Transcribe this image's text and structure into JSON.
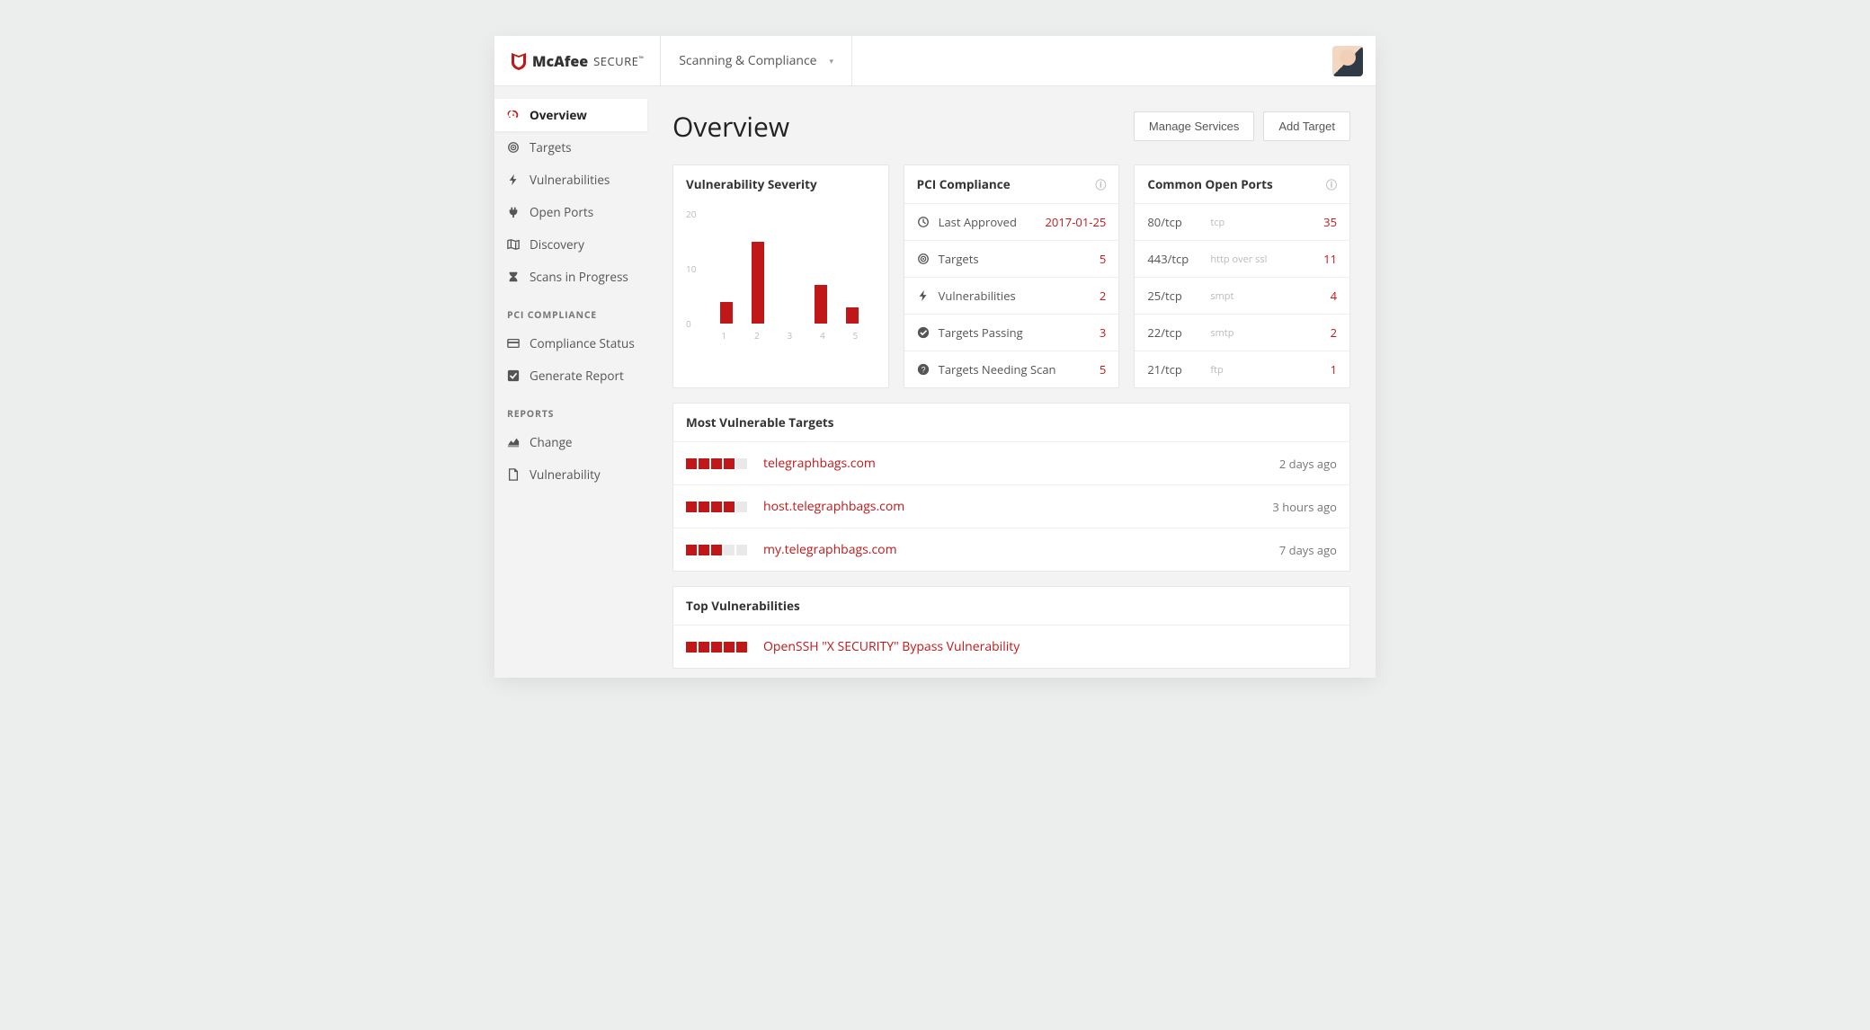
{
  "brand": {
    "part1": "McAfee",
    "part2": "SECURE",
    "tm": "™"
  },
  "header": {
    "nav_label": "Scanning & Compliance"
  },
  "sidebar": {
    "main": [
      {
        "label": "Overview",
        "icon": "gauge",
        "active": true
      },
      {
        "label": "Targets",
        "icon": "target",
        "active": false
      },
      {
        "label": "Vulnerabilities",
        "icon": "bolt",
        "active": false
      },
      {
        "label": "Open Ports",
        "icon": "plug",
        "active": false
      },
      {
        "label": "Discovery",
        "icon": "map",
        "active": false
      },
      {
        "label": "Scans in Progress",
        "icon": "hourglass",
        "active": false
      }
    ],
    "section_pci": "PCI COMPLIANCE",
    "pci": [
      {
        "label": "Compliance Status",
        "icon": "card"
      },
      {
        "label": "Generate Report",
        "icon": "check-box"
      }
    ],
    "section_reports": "REPORTS",
    "reports": [
      {
        "label": "Change",
        "icon": "chart-area"
      },
      {
        "label": "Vulnerability",
        "icon": "file"
      }
    ]
  },
  "page": {
    "title": "Overview",
    "actions": {
      "manage": "Manage Services",
      "add": "Add Target"
    }
  },
  "cards": {
    "severity": {
      "title": "Vulnerability Severity"
    },
    "pci_title": "PCI Compliance",
    "ports_title": "Common Open Ports"
  },
  "pci": [
    {
      "icon": "clock",
      "label": "Last Approved",
      "value": "2017-01-25"
    },
    {
      "icon": "target",
      "label": "Targets",
      "value": "5"
    },
    {
      "icon": "bolt",
      "label": "Vulnerabilities",
      "value": "2"
    },
    {
      "icon": "check",
      "label": "Targets Passing",
      "value": "3"
    },
    {
      "icon": "question",
      "label": "Targets Needing Scan",
      "value": "5"
    }
  ],
  "ports": [
    {
      "port": "80/tcp",
      "proto": "tcp",
      "count": "35"
    },
    {
      "port": "443/tcp",
      "proto": "http over ssl",
      "count": "11"
    },
    {
      "port": "25/tcp",
      "proto": "smpt",
      "count": "4"
    },
    {
      "port": "22/tcp",
      "proto": "smtp",
      "count": "2"
    },
    {
      "port": "21/tcp",
      "proto": "ftp",
      "count": "1"
    }
  ],
  "vuln_targets": {
    "title": "Most Vulnerable Targets",
    "items": [
      {
        "sev": 4,
        "name": "telegraphbags.com",
        "when": "2 days ago"
      },
      {
        "sev": 4,
        "name": "host.telegraphbags.com",
        "when": "3 hours ago"
      },
      {
        "sev": 3,
        "name": "my.telegraphbags.com",
        "when": "7 days ago"
      }
    ]
  },
  "top_vulns": {
    "title": "Top Vulnerabilities",
    "items": [
      {
        "sev": 5,
        "name": "OpenSSH \"X SECURITY\" Bypass Vulnerability"
      }
    ]
  },
  "chart_data": {
    "type": "bar",
    "title": "Vulnerability Severity",
    "xlabel": "",
    "ylabel": "",
    "ylim": [
      0,
      20
    ],
    "yticks": [
      0,
      10,
      20
    ],
    "categories": [
      "1",
      "2",
      "3",
      "4",
      "5"
    ],
    "values": [
      4,
      15,
      0,
      7,
      3
    ]
  }
}
